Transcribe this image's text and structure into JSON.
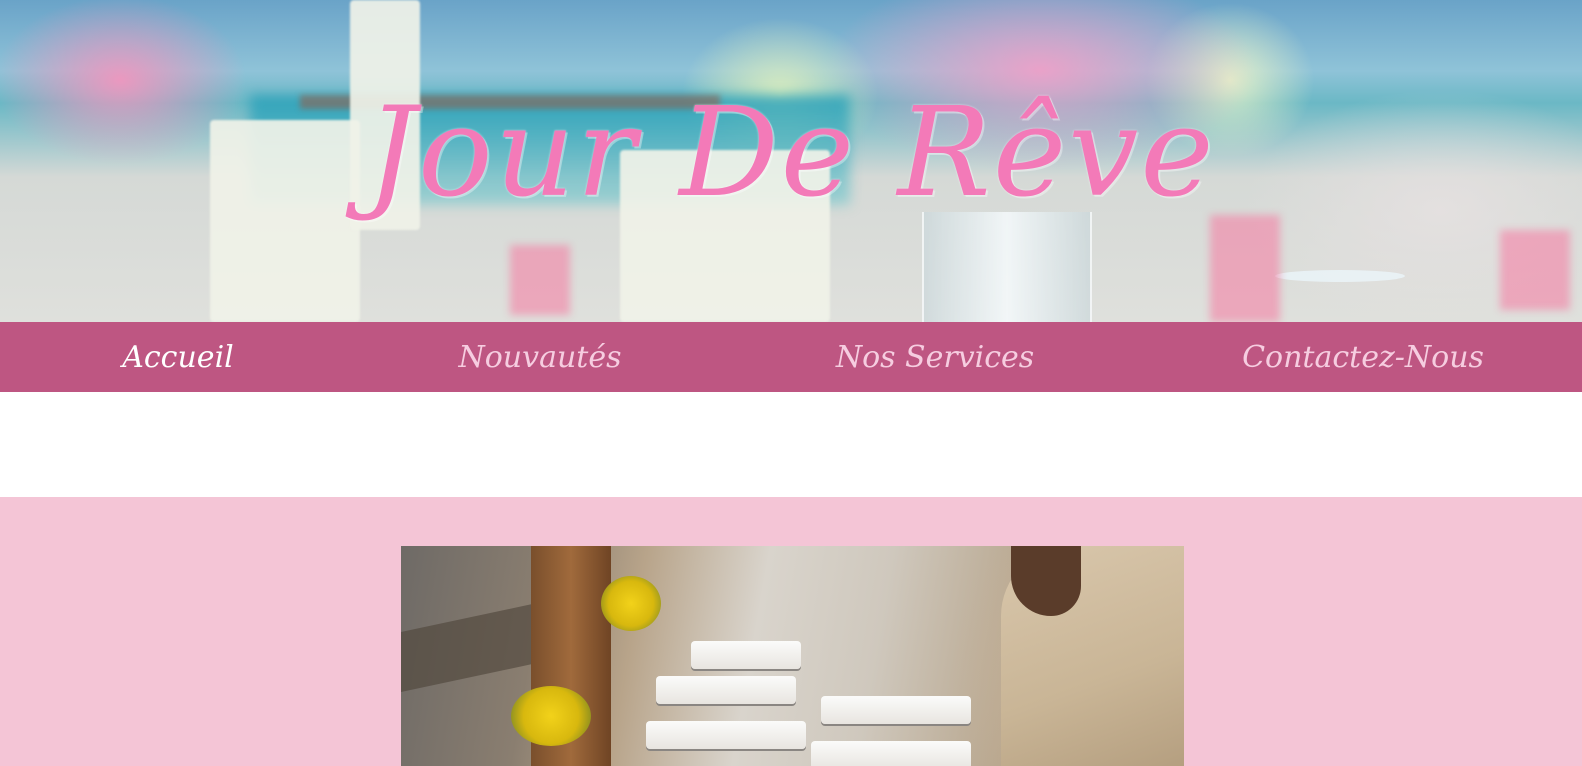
{
  "site": {
    "title": "Jour De Rêve"
  },
  "nav": {
    "items": [
      {
        "label": "Accueil",
        "active": true
      },
      {
        "label": "Nouvautés",
        "active": false
      },
      {
        "label": "Nos Services",
        "active": false
      },
      {
        "label": "Contactez-Nous",
        "active": false
      }
    ]
  },
  "colors": {
    "nav_bg": "#be5682",
    "nav_text": "#f6cde0",
    "nav_active_text": "#ffffff",
    "title_pink": "#f37ab8",
    "section_pink": "#f4c5d6"
  },
  "images": {
    "hero": "wedding-table-flowers",
    "content": "buffet-catering"
  }
}
